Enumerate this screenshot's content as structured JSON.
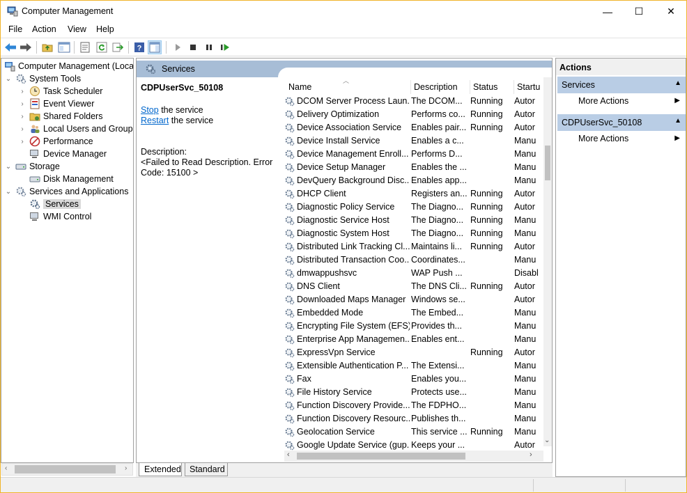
{
  "window": {
    "title": "Computer Management",
    "minimize": "—",
    "maximize": "☐",
    "close": "✕"
  },
  "menu": [
    "File",
    "Action",
    "View",
    "Help"
  ],
  "toolbar": [
    "back-icon",
    "forward-icon",
    "up-folder-icon",
    "show-hide-tree-icon",
    "properties-icon",
    "refresh-icon",
    "export-icon",
    "help-icon",
    "show-action-pane-icon",
    "start-service-icon",
    "stop-service-icon",
    "pause-service-icon",
    "resume-service-icon"
  ],
  "tree": {
    "root": "Computer Management (Local",
    "items": [
      {
        "label": "System Tools",
        "level": 1,
        "expand": "⌄",
        "icon": "tools-icon"
      },
      {
        "label": "Task Scheduler",
        "level": 2,
        "expand": "›",
        "icon": "clock-icon"
      },
      {
        "label": "Event Viewer",
        "level": 2,
        "expand": "›",
        "icon": "event-viewer-icon"
      },
      {
        "label": "Shared Folders",
        "level": 2,
        "expand": "›",
        "icon": "shared-folder-icon"
      },
      {
        "label": "Local Users and Groups",
        "level": 2,
        "expand": "›",
        "icon": "users-icon"
      },
      {
        "label": "Performance",
        "level": 2,
        "expand": "›",
        "icon": "performance-icon"
      },
      {
        "label": "Device Manager",
        "level": 2,
        "expand": "",
        "icon": "device-manager-icon"
      },
      {
        "label": "Storage",
        "level": 1,
        "expand": "⌄",
        "icon": "storage-icon"
      },
      {
        "label": "Disk Management",
        "level": 2,
        "expand": "",
        "icon": "disk-icon"
      },
      {
        "label": "Services and Applications",
        "level": 1,
        "expand": "⌄",
        "icon": "services-apps-icon"
      },
      {
        "label": "Services",
        "level": 2,
        "expand": "",
        "icon": "gear-icon",
        "selected": true
      },
      {
        "label": "WMI Control",
        "level": 2,
        "expand": "",
        "icon": "wmi-icon"
      }
    ]
  },
  "center": {
    "header": "Services",
    "detail": {
      "name": "CDPUserSvc_50108",
      "stop_link": "Stop",
      "stop_rest": " the service",
      "restart_link": "Restart",
      "restart_rest": " the service",
      "desc_label": "Description:",
      "desc_text": "<Failed to Read Description. Error Code: 15100 >"
    },
    "columns": [
      "Name",
      "Description",
      "Status",
      "Startu"
    ],
    "rows": [
      [
        "DCOM Server Process Laun...",
        "The DCOM...",
        "Running",
        "Autor"
      ],
      [
        "Delivery Optimization",
        "Performs co...",
        "Running",
        "Autor"
      ],
      [
        "Device Association Service",
        "Enables pair...",
        "Running",
        "Autor"
      ],
      [
        "Device Install Service",
        "Enables a c...",
        "",
        "Manu"
      ],
      [
        "Device Management Enroll...",
        "Performs D...",
        "",
        "Manu"
      ],
      [
        "Device Setup Manager",
        "Enables the ...",
        "",
        "Manu"
      ],
      [
        "DevQuery Background Disc...",
        "Enables app...",
        "",
        "Manu"
      ],
      [
        "DHCP Client",
        "Registers an...",
        "Running",
        "Autor"
      ],
      [
        "Diagnostic Policy Service",
        "The Diagno...",
        "Running",
        "Autor"
      ],
      [
        "Diagnostic Service Host",
        "The Diagno...",
        "Running",
        "Manu"
      ],
      [
        "Diagnostic System Host",
        "The Diagno...",
        "Running",
        "Manu"
      ],
      [
        "Distributed Link Tracking Cl...",
        "Maintains li...",
        "Running",
        "Autor"
      ],
      [
        "Distributed Transaction Coo...",
        "Coordinates...",
        "",
        "Manu"
      ],
      [
        "dmwappushsvc",
        "WAP Push ...",
        "",
        "Disabl"
      ],
      [
        "DNS Client",
        "The DNS Cli...",
        "Running",
        "Autor"
      ],
      [
        "Downloaded Maps Manager",
        "Windows se...",
        "",
        "Autor"
      ],
      [
        "Embedded Mode",
        "The Embed...",
        "",
        "Manu"
      ],
      [
        "Encrypting File System (EFS)",
        "Provides th...",
        "",
        "Manu"
      ],
      [
        "Enterprise App Managemen...",
        "Enables ent...",
        "",
        "Manu"
      ],
      [
        "ExpressVpn Service",
        "",
        "Running",
        "Autor"
      ],
      [
        "Extensible Authentication P...",
        "The Extensi...",
        "",
        "Manu"
      ],
      [
        "Fax",
        "Enables you...",
        "",
        "Manu"
      ],
      [
        "File History Service",
        "Protects use...",
        "",
        "Manu"
      ],
      [
        "Function Discovery Provide...",
        "The FDPHO...",
        "",
        "Manu"
      ],
      [
        "Function Discovery Resourc...",
        "Publishes th...",
        "",
        "Manu"
      ],
      [
        "Geolocation Service",
        "This service ...",
        "Running",
        "Manu"
      ],
      [
        "Google Update Service (gup...",
        "Keeps your ...",
        "",
        "Autor"
      ]
    ],
    "tabs": [
      "Extended",
      "Standard"
    ]
  },
  "actions": {
    "title": "Actions",
    "sections": [
      {
        "title": "Services",
        "item": "More Actions"
      },
      {
        "title": "CDPUserSvc_50108",
        "item": "More Actions"
      }
    ]
  }
}
